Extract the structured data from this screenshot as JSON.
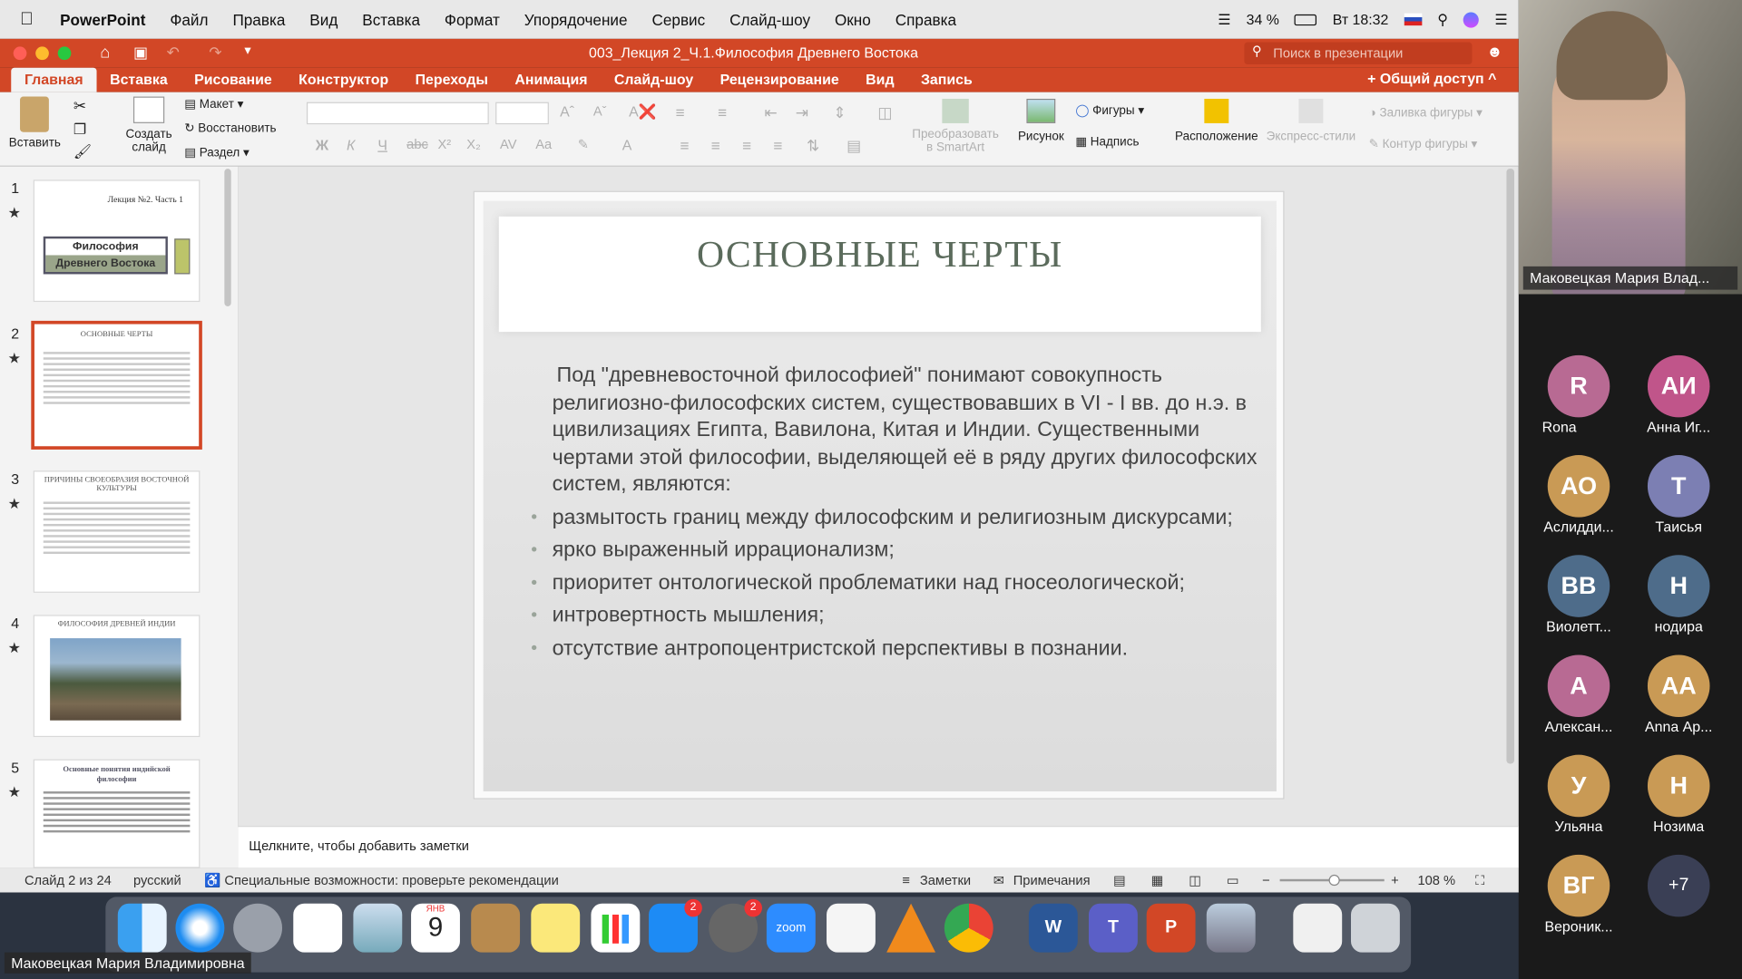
{
  "menubar": {
    "app_name": "PowerPoint",
    "items": [
      "Файл",
      "Правка",
      "Вид",
      "Вставка",
      "Формат",
      "Упорядочение",
      "Сервис",
      "Слайд-шоу",
      "Окно",
      "Справка"
    ],
    "battery": "34 %",
    "time": "Вт 18:32"
  },
  "window": {
    "title": "003_Лекция 2_Ч.1.Философия Древнего Востока",
    "search_placeholder": "Поиск в презентации",
    "share_label": "Общий доступ"
  },
  "tabs": [
    "Главная",
    "Вставка",
    "Рисование",
    "Конструктор",
    "Переходы",
    "Анимация",
    "Слайд-шоу",
    "Рецензирование",
    "Вид",
    "Запись"
  ],
  "ribbon": {
    "paste": "Вставить",
    "new_slide": "Создать слайд",
    "layout": "Макет",
    "reset": "Восстановить",
    "section": "Раздел",
    "convert_smartart": "Преобразовать в SmartArt",
    "picture": "Рисунок",
    "shapes": "Фигуры",
    "textbox": "Надпись",
    "arrange": "Расположение",
    "quick_styles": "Экспресс-стили",
    "shape_fill": "Заливка фигуры",
    "shape_outline": "Контур фигуры"
  },
  "thumbnails": [
    {
      "num": "1",
      "caption": "Лекция №2. Часть 1",
      "title": "Философия Древнего Востока"
    },
    {
      "num": "2",
      "title": "ОСНОВНЫЕ ЧЕРТЫ"
    },
    {
      "num": "3",
      "title": "ПРИЧИНЫ СВОЕОБРАЗИЯ ВОСТОЧНОЙ КУЛЬТУРЫ"
    },
    {
      "num": "4",
      "title": "ФИЛОСОФИЯ ДРЕВНЕЙ ИНДИИ"
    },
    {
      "num": "5",
      "title": "Основные понятия индийской философии"
    }
  ],
  "slide": {
    "title": "ОСНОВНЫЕ ЧЕРТЫ",
    "intro": "Под \"древневосточной философией\" понимают совокупность религиозно-философских систем, существовавших в VI - I вв. до н.э. в цивилизациях Египта, Вавилона, Китая и Индии. Существенными чертами этой философии, выделяющей её в ряду других философских систем, являются:",
    "bullets": [
      "размытость границ между философским и религиозным дискурсами;",
      "ярко выраженный иррационализм;",
      "приоритет онтологической проблематики над гносеологической;",
      "интровертность мышления;",
      "отсутствие антропоцентристской перспективы в познании."
    ]
  },
  "notes_placeholder": "Щелкните, чтобы добавить заметки",
  "status": {
    "slide_of": "Слайд 2 из 24",
    "language": "русский",
    "accessibility": "Специальные возможности: проверьте рекомендации",
    "notes": "Заметки",
    "comments": "Примечания",
    "zoom": "108 %"
  },
  "dock": {
    "calendar_month": "ЯНВ",
    "calendar_day": "9",
    "badges": [
      "2",
      "2"
    ],
    "zoom_label": "zoom"
  },
  "speaker_label": "Маковецкая Мария Владимировна",
  "zoom_panel": {
    "video_name": "Маковецкая Мария Влад...",
    "participants": [
      {
        "initials": "R",
        "name": "Rona",
        "color": "#b86a93"
      },
      {
        "initials": "АИ",
        "name": "Анна Иг...",
        "color": "#c0558a"
      },
      {
        "initials": "АО",
        "name": "Аслидди...",
        "color": "#c99a55"
      },
      {
        "initials": "Т",
        "name": "Таисья",
        "color": "#7c7fb3"
      },
      {
        "initials": "ВВ",
        "name": "Виолетт...",
        "color": "#4e6c8a"
      },
      {
        "initials": "Н",
        "name": "нодира",
        "color": "#4e6c8a"
      },
      {
        "initials": "А",
        "name": "Алексан...",
        "color": "#b86a93"
      },
      {
        "initials": "АА",
        "name": "Anna Ар...",
        "color": "#c99a55"
      },
      {
        "initials": "У",
        "name": "Ульяна",
        "color": "#c99a55"
      },
      {
        "initials": "Н",
        "name": "Нозима",
        "color": "#c99a55"
      },
      {
        "initials": "ВГ",
        "name": "Вероник...",
        "color": "#c99a55"
      },
      {
        "initials": "+7",
        "name": "",
        "color": "#3a3f55"
      }
    ]
  }
}
